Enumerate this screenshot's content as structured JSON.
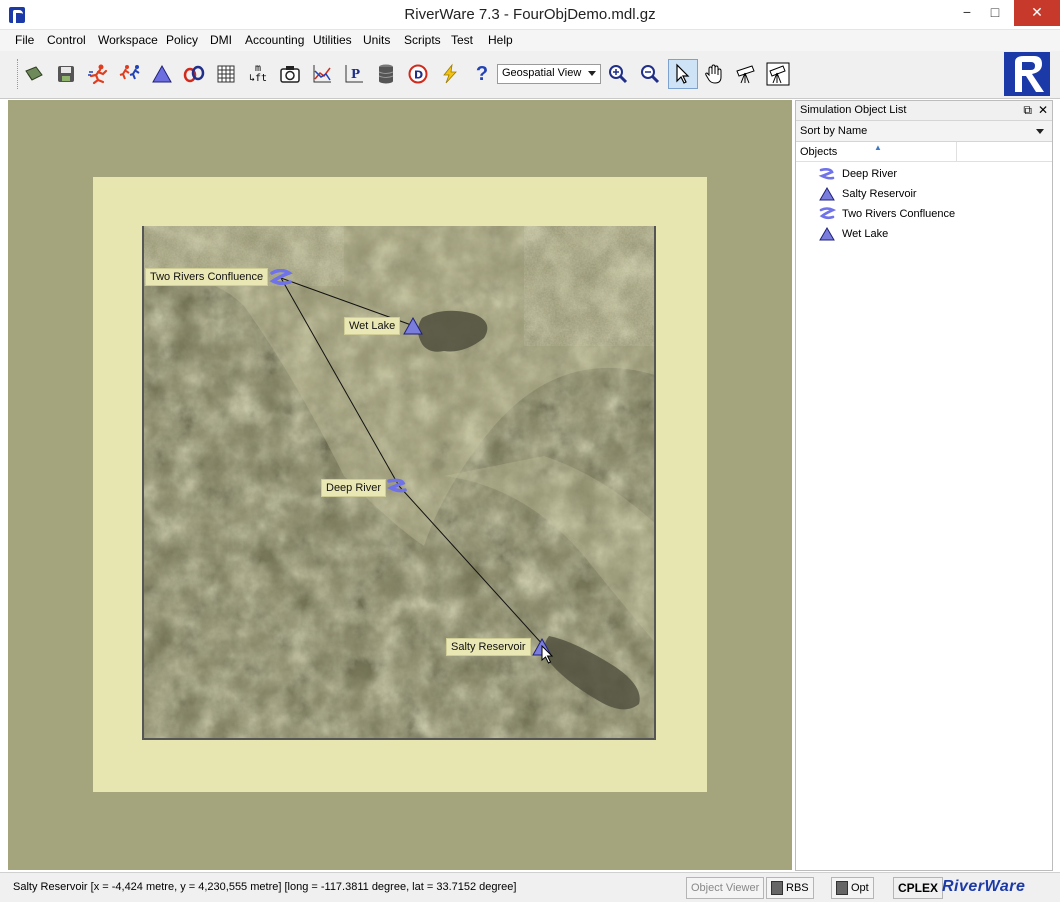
{
  "window": {
    "title": "RiverWare 7.3 - FourObjDemo.mdl.gz",
    "min_glyph": "−",
    "max_glyph": "□",
    "close_glyph": "✕"
  },
  "menu": {
    "items": [
      "File",
      "Control",
      "Workspace",
      "Policy",
      "DMI",
      "Accounting",
      "Utilities",
      "Units",
      "Scripts",
      "Test",
      "Help"
    ]
  },
  "toolbar": {
    "icons": [
      "open-icon",
      "save-icon",
      "run-icon",
      "multi-run-icon",
      "reservoir-icon",
      "link-icon",
      "table-icon",
      "unit-convert-icon",
      "snapshot-icon",
      "plot-icon",
      "policy-icon",
      "database-icon",
      "dmi-icon",
      "lightning-icon",
      "help-icon",
      "zoom-in-icon",
      "zoom-out-icon",
      "select-pointer-icon",
      "pan-hand-icon",
      "telescope-icon",
      "framed-telescope-icon"
    ],
    "help_glyph": "?",
    "unit_top": "m",
    "unit_bottom": "↳ft",
    "view_select_value": "Geospatial View",
    "active_tool": "select-pointer-icon"
  },
  "map": {
    "objects": [
      {
        "name": "Two Rivers Confluence",
        "type": "confluence"
      },
      {
        "name": "Wet Lake",
        "type": "reservoir"
      },
      {
        "name": "Deep River",
        "type": "reach"
      },
      {
        "name": "Salty Reservoir",
        "type": "reservoir"
      }
    ]
  },
  "panel": {
    "title": "Simulation Object List",
    "restore_glyph": "⧉",
    "close_glyph": "✕",
    "sort_value": "Sort by Name",
    "column_header": "Objects",
    "sort_caret": "▲",
    "items": [
      {
        "name": "Deep River",
        "icon": "reach-icon"
      },
      {
        "name": "Salty Reservoir",
        "icon": "reservoir-icon"
      },
      {
        "name": "Two Rivers Confluence",
        "icon": "confluence-icon"
      },
      {
        "name": "Wet Lake",
        "icon": "reservoir-icon"
      }
    ]
  },
  "status": {
    "text": "Salty Reservoir [x = -4,424 metre, y = 4,230,555 metre] [long = -117.3811 degree, lat = 33.7152 degree]",
    "object_viewer": "Object Viewer",
    "rbs": "RBS",
    "opt": "Opt",
    "cplex": "CPLEX",
    "brand": "RiverWare"
  },
  "colors": {
    "workspace_bg": "#a4a57d",
    "map_frame": "#e8e6b0",
    "object_icon": "#7b7ddc",
    "brand_blue": "#1b3aa8",
    "close_red": "#c7392b"
  }
}
